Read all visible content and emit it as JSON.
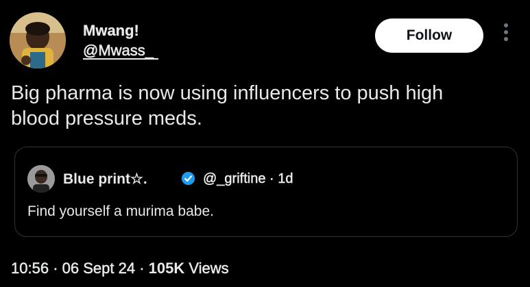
{
  "author": {
    "name": "Mwang!",
    "handle": "@Mwass_",
    "avatar_icon": "profile-photo"
  },
  "follow_label": "Follow",
  "more_icon": "more-options-icon",
  "tweet": {
    "line1": "Big pharma is now using influencers to push high",
    "line2": "blood pressure meds."
  },
  "quote": {
    "name": "Blue print☆.",
    "verified_icon": "verified-badge-icon",
    "handle": "@_griftine",
    "separator": "·",
    "age": "1d",
    "text": "Find yourself a murima babe."
  },
  "footer": {
    "time": "10:56",
    "separator": "·",
    "date": "06 Sept 24",
    "views_count": "105K",
    "views_label": "Views"
  },
  "colors": {
    "background": "#000000",
    "text": "#e7e9ea",
    "muted": "#71767b",
    "border": "#2f3336",
    "verified": "#1d9bf0",
    "follow_bg": "#ffffff"
  }
}
